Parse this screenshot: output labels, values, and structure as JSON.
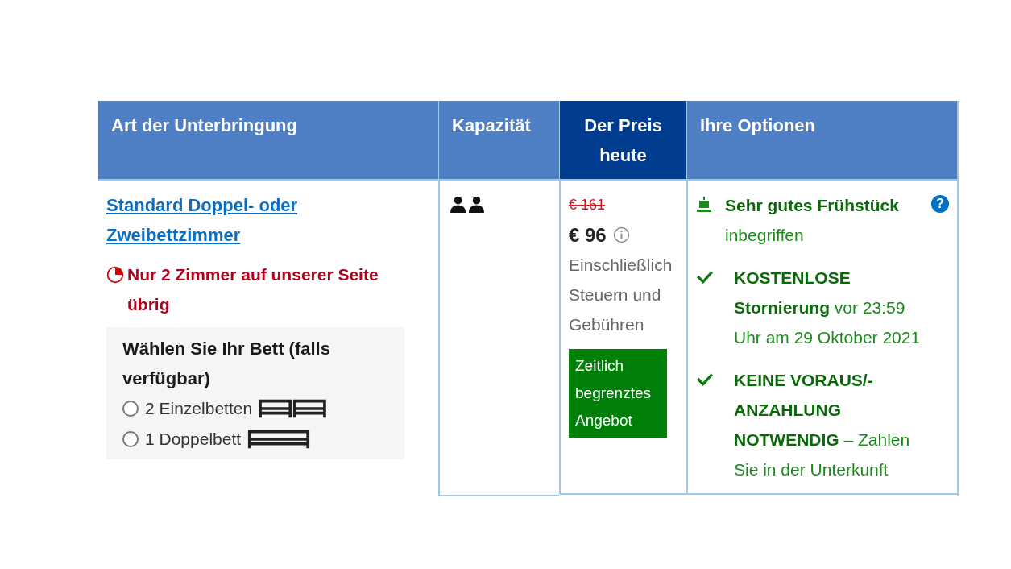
{
  "table": {
    "columns": [
      {
        "label": "Art der Unterbringung",
        "selected": false
      },
      {
        "label": "Kapazität",
        "selected": false
      },
      {
        "label": "Der Preis heute",
        "selected": true
      },
      {
        "label": "Ihre Optionen",
        "selected": false
      }
    ],
    "rows": [
      {
        "room_name": "Standard Doppel- oder Zweibettzimmer",
        "scarcity": "Nur 2 Zimmer auf unserer Seite übrig",
        "bed_choice": {
          "title": "Wählen Sie Ihr Bett (falls verfügbar)",
          "options": [
            {
              "label": "2 Einzelbetten",
              "kind": "single",
              "selected": false
            },
            {
              "label": "1 Doppelbett",
              "kind": "double",
              "selected": false
            }
          ]
        },
        "old_price": "€ 161",
        "price": "€ 96",
        "price_note": "Einschließlich Steuern und Gebühren",
        "deal_badge": "Zeitlich begrenztes Angebot",
        "options": [
          {
            "kind": "breakfast",
            "text": "**Sehr gutes Frühstück** inbegriffen",
            "help": "?"
          },
          {
            "kind": "check",
            "text": "**KOSTENLOSE Stornierung** vor 23:59 Uhr am 29 Oktober 2021"
          },
          {
            "kind": "check",
            "text": "**KEINE VORAUS/-ANZAHLUNG NOTWENDIG** – Zahlen Sie in der Unterkunft"
          }
        ]
      }
    ]
  }
}
